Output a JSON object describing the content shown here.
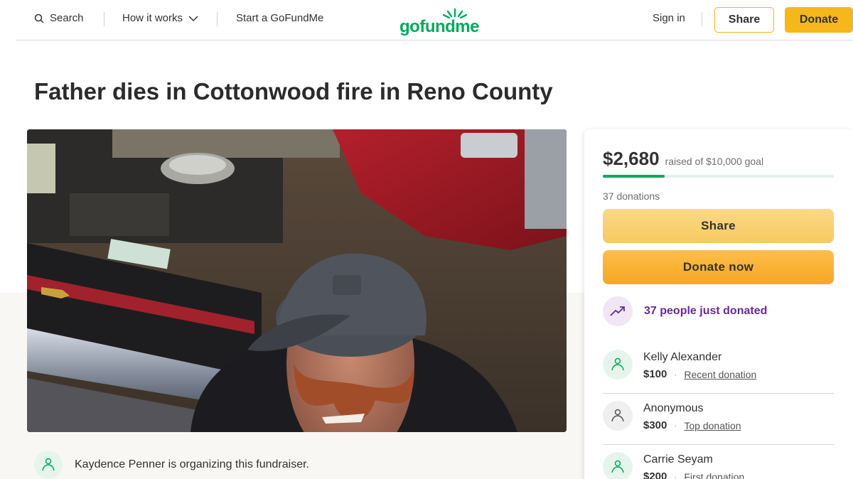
{
  "header": {
    "search_label": "Search",
    "how_it_works_label": "How it works",
    "start_label": "Start a GoFundMe",
    "logo_text": "gofundme",
    "sign_in_label": "Sign in",
    "share_label": "Share",
    "donate_label": "Donate"
  },
  "campaign": {
    "title": "Father dies in Cottonwood fire in Reno County",
    "organizer_text": "Kaydence Penner is organizing this fundraiser."
  },
  "sidebar": {
    "raised_amount": "$2,680",
    "raised_goal_text": "raised of $10,000 goal",
    "progress_fraction": 0.268,
    "donation_count_text": "37 donations",
    "share_label": "Share",
    "donate_label": "Donate now",
    "trend_text": "37 people just donated",
    "donors": [
      {
        "name": "Kelly Alexander",
        "amount": "$100",
        "tag": "Recent donation"
      },
      {
        "name": "Anonymous",
        "amount": "$300",
        "tag": "Top donation"
      },
      {
        "name": "Carrie Seyam",
        "amount": "$200",
        "tag": "First donation"
      }
    ]
  },
  "colors": {
    "brand_green": "#02a95c",
    "accent_yellow": "#f5b71c",
    "trend_purple": "#6a2b8f"
  },
  "icons": [
    "search-icon",
    "chevron-down-icon",
    "trend-up-icon",
    "heart-hand-icon"
  ]
}
